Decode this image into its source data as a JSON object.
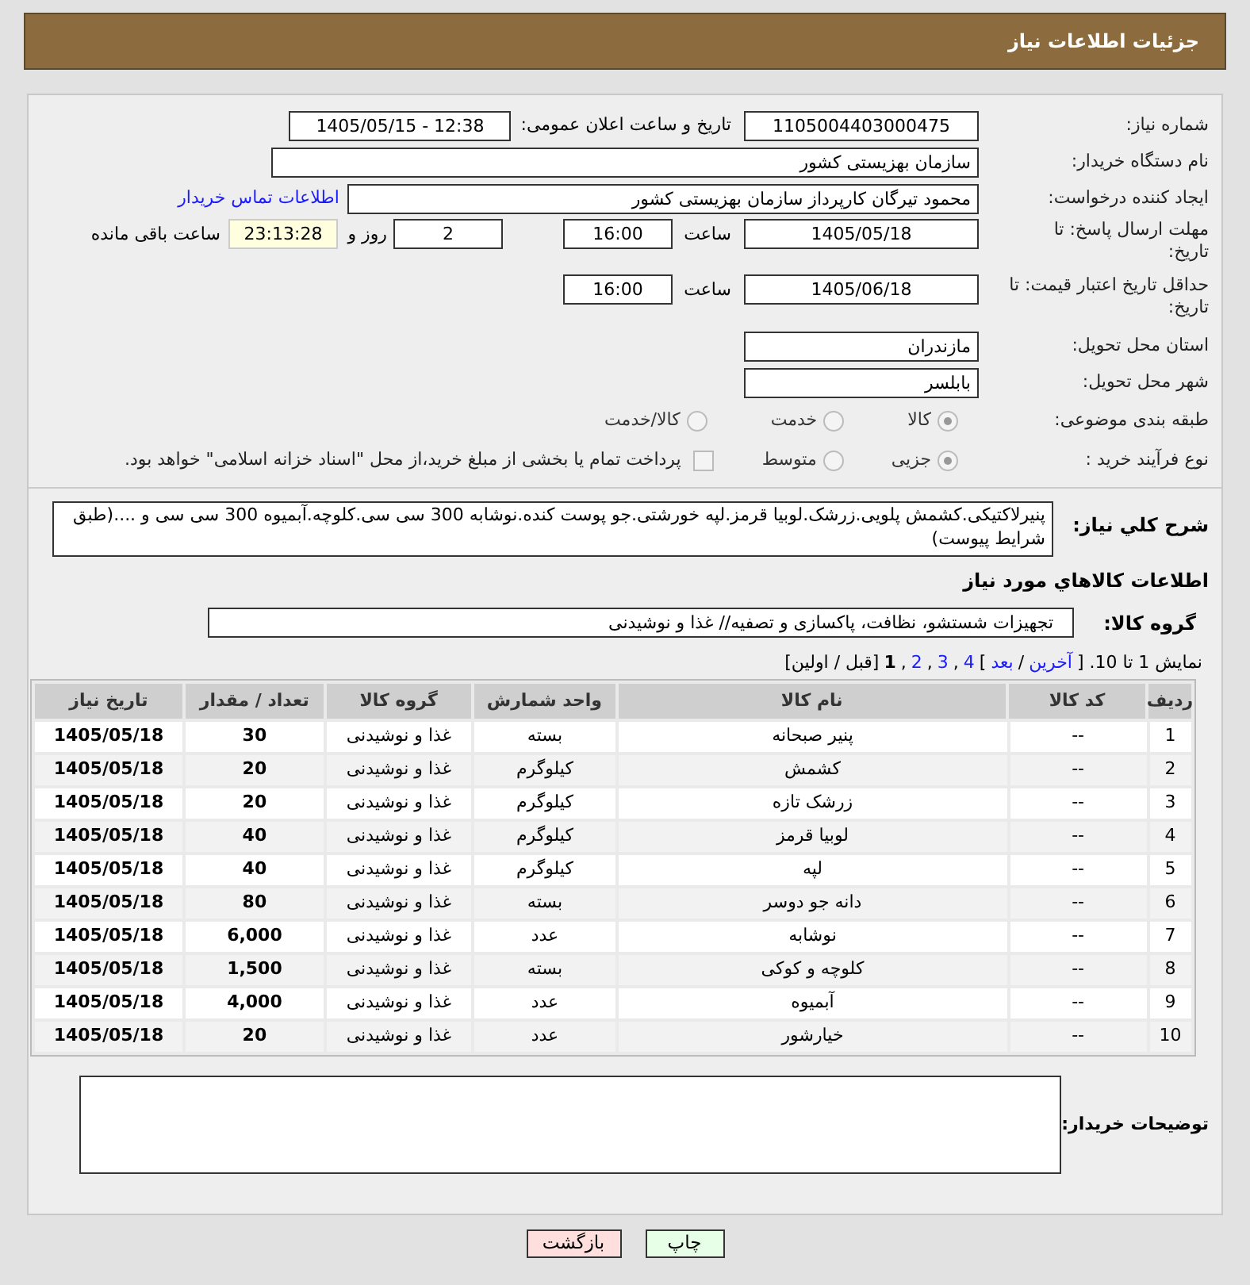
{
  "header": {
    "title": "جزئیات اطلاعات نیاز"
  },
  "form": {
    "need_number": {
      "label": "شماره نیاز:",
      "value": "1105004403000475"
    },
    "announce": {
      "label": "تاریخ و ساعت اعلان عمومی:",
      "value": "1405/05/15 - 12:38"
    },
    "buyer_org": {
      "label": "نام دستگاه خریدار:",
      "value": "سازمان بهزیستی کشور"
    },
    "creator": {
      "label": "ایجاد کننده درخواست:",
      "value": "محمود تیرگان کارپرداز سازمان بهزیستی کشور",
      "link": "اطلاعات تماس خریدار"
    },
    "deadline": {
      "label": "مهلت ارسال پاسخ: تا تاریخ:",
      "date": "1405/05/18",
      "time_label": "ساعت",
      "time": "16:00",
      "days": "2",
      "days_label": "روز و",
      "remaining": "23:13:28",
      "remaining_label": "ساعت باقی مانده"
    },
    "validity": {
      "label": "حداقل تاریخ اعتبار قیمت: تا تاریخ:",
      "date": "1405/06/18",
      "time_label": "ساعت",
      "time": "16:00"
    },
    "province": {
      "label": "استان محل تحویل:",
      "value": "مازندران"
    },
    "city": {
      "label": "شهر محل تحویل:",
      "value": "بابلسر"
    },
    "category": {
      "label": "طبقه بندی موضوعی:",
      "options": [
        {
          "label": "کالا",
          "selected": true
        },
        {
          "label": "خدمت",
          "selected": false
        },
        {
          "label": "کالا/خدمت",
          "selected": false
        }
      ]
    },
    "process": {
      "label": "نوع فرآیند خرید :",
      "options": [
        {
          "label": "جزیی",
          "selected": true
        },
        {
          "label": "متوسط",
          "selected": false
        }
      ],
      "payment": {
        "label": "پرداخت تمام یا بخشی از مبلغ خرید،از محل \"اسناد خزانه اسلامی\" خواهد بود.",
        "checked": false
      }
    },
    "description": {
      "label": "شرح کلي نياز:",
      "value": "پنیرلاکتیکی.کشمش پلویی.زرشک.لوبیا قرمز.لپه خورشتی.جو پوست کنده.نوشابه 300 سی سی.کلوچه.آبمیوه 300 سی سی و ....(طبق شرایط پیوست)"
    },
    "items_title": "اطلاعات کالاهاي مورد نياز",
    "group": {
      "label": "گروه کالا:",
      "value": "تجهیزات شستشو، نظافت، پاکسازی و تصفیه// غذا و نوشیدنی"
    }
  },
  "pagination": [
    {
      "kind": "text",
      "label": "نمایش 1 تا 10. ["
    },
    {
      "kind": "link",
      "label": "آخرین"
    },
    {
      "kind": "text",
      "label": "/"
    },
    {
      "kind": "link",
      "label": "بعد"
    },
    {
      "kind": "text",
      "label": "]"
    },
    {
      "kind": "page",
      "label": "4",
      "selected": false
    },
    {
      "kind": "text",
      "label": ","
    },
    {
      "kind": "page",
      "label": "3",
      "selected": false
    },
    {
      "kind": "text",
      "label": ","
    },
    {
      "kind": "page",
      "label": "2",
      "selected": false
    },
    {
      "kind": "text",
      "label": ","
    },
    {
      "kind": "page",
      "label": "1",
      "selected": true
    },
    {
      "kind": "text",
      "label": "[قبل / اولین]"
    }
  ],
  "table": {
    "columns": [
      "ردیف",
      "کد کالا",
      "نام کالا",
      "واحد شمارش",
      "گروه کالا",
      "تعداد / مقدار",
      "تاریخ نیاز"
    ],
    "rows": [
      [
        "1",
        "--",
        "پنیر صبحانه",
        "بسته",
        "غذا و نوشیدنی",
        "30",
        "1405/05/18"
      ],
      [
        "2",
        "--",
        "کشمش",
        "کیلوگرم",
        "غذا و نوشیدنی",
        "20",
        "1405/05/18"
      ],
      [
        "3",
        "--",
        "زرشک تازه",
        "کیلوگرم",
        "غذا و نوشیدنی",
        "20",
        "1405/05/18"
      ],
      [
        "4",
        "--",
        "لوبیا قرمز",
        "کیلوگرم",
        "غذا و نوشیدنی",
        "40",
        "1405/05/18"
      ],
      [
        "5",
        "--",
        "لپه",
        "کیلوگرم",
        "غذا و نوشیدنی",
        "40",
        "1405/05/18"
      ],
      [
        "6",
        "--",
        "دانه جو دوسر",
        "بسته",
        "غذا و نوشیدنی",
        "80",
        "1405/05/18"
      ],
      [
        "7",
        "--",
        "نوشابه",
        "عدد",
        "غذا و نوشیدنی",
        "6,000",
        "1405/05/18"
      ],
      [
        "8",
        "--",
        "کلوچه و کوکی",
        "بسته",
        "غذا و نوشیدنی",
        "1,500",
        "1405/05/18"
      ],
      [
        "9",
        "--",
        "آبمیوه",
        "عدد",
        "غذا و نوشیدنی",
        "4,000",
        "1405/05/18"
      ],
      [
        "10",
        "--",
        "خیارشور",
        "عدد",
        "غذا و نوشیدنی",
        "20",
        "1405/05/18"
      ]
    ]
  },
  "buyer_notes": {
    "label": "توضیحات خریدار:"
  },
  "buttons": [
    {
      "kind": "print",
      "label": "چاپ"
    },
    {
      "kind": "back",
      "label": "بازگشت"
    }
  ]
}
